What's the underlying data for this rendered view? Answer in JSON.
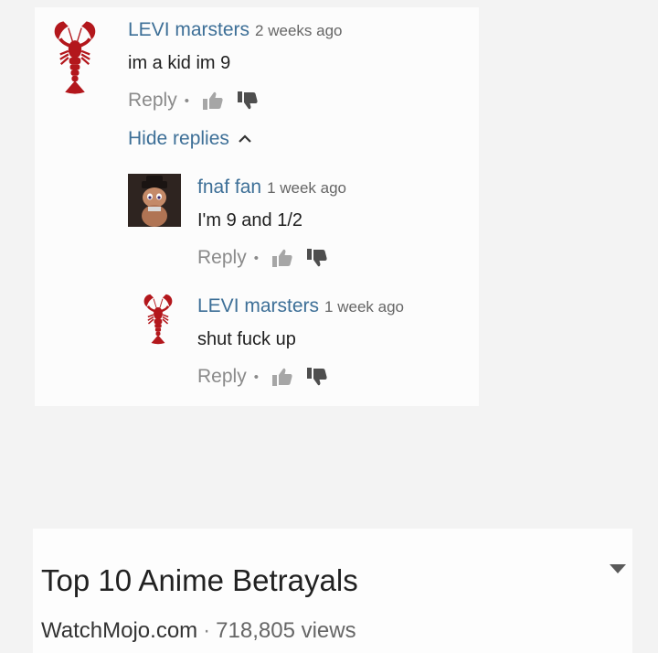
{
  "colors": {
    "background": "#f3f3f3",
    "card": "#fcfcfc",
    "author_link": "#3d6f97",
    "muted": "#8a8a8a",
    "lobster_red": "#b3171c"
  },
  "comments": [
    {
      "author": "LEVI marsters",
      "time": "2 weeks ago",
      "text": "im a kid im 9",
      "reply_label": "Reply",
      "avatar_icon": "lobster-icon"
    },
    {
      "author": "fnaf fan",
      "time": "1 week ago",
      "text": "I'm 9 and 1/2",
      "reply_label": "Reply",
      "avatar_icon": "cartoon-character-avatar"
    },
    {
      "author": "LEVI marsters",
      "time": "1 week ago",
      "text": "shut fuck up",
      "reply_label": "Reply",
      "avatar_icon": "lobster-icon"
    }
  ],
  "hide_replies_label": "Hide replies",
  "separator": "•",
  "video": {
    "title": "Top 10 Anime Betrayals",
    "channel": "WatchMojo.com",
    "meta_separator": "·",
    "views": "718,805 views",
    "expand_icon": "dropdown-arrow-icon"
  }
}
